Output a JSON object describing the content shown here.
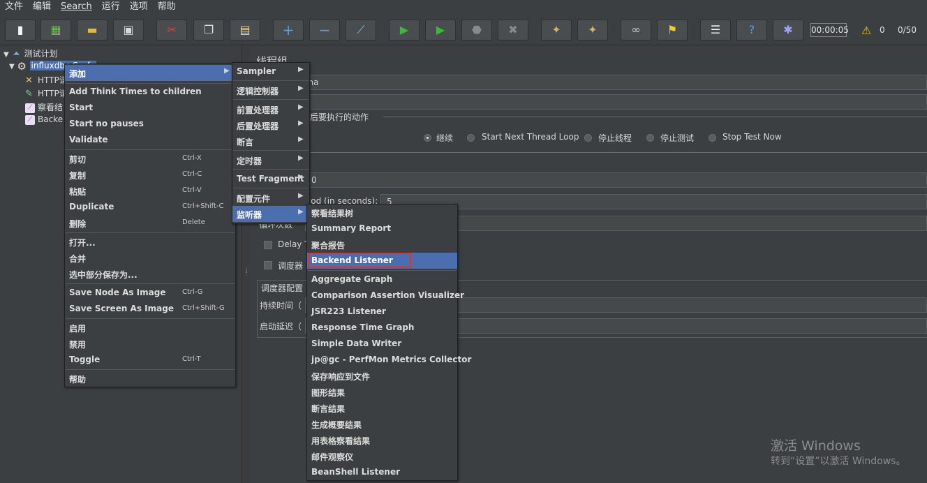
{
  "menubar": [
    "文件",
    "编辑",
    "Search",
    "运行",
    "选项",
    "帮助"
  ],
  "toolbar": {
    "timer": "00:00:05",
    "warn_count": "0",
    "threads": "0/50"
  },
  "tree": {
    "root": "测试计划",
    "thread_group": "influxdb+Grafana",
    "thread_group_visible": "influxdb+Grafa",
    "children": [
      "HTTP请",
      "HTTP请",
      "察看结",
      "Backe"
    ]
  },
  "panel": {
    "title": "线程组",
    "name_value": "xdb+Grafana",
    "action_section": "误后要执行的动作",
    "radios": [
      "继续",
      "Start Next Thread Loop",
      "停止线程",
      "停止测试",
      "Stop Test Now"
    ],
    "threads_value": "0",
    "rampup_label": "riod (in seconds):",
    "rampup_value": "5",
    "loop_label": "循环次数",
    "delay_label": "Delay T",
    "scheduler_label": "调度器",
    "scheduler_section": "调度器配置",
    "duration_label": "持续时间（",
    "startup_label": "启动延迟（"
  },
  "context_menu": {
    "items": [
      {
        "label": "添加",
        "shortcut": "",
        "submenu": true,
        "highlight": true
      },
      {
        "label": "Add Think Times to children",
        "shortcut": ""
      },
      {
        "label": "Start",
        "shortcut": ""
      },
      {
        "label": "Start no pauses",
        "shortcut": ""
      },
      {
        "label": "Validate",
        "shortcut": ""
      },
      {
        "label": "剪切",
        "shortcut": "Ctrl-X"
      },
      {
        "label": "复制",
        "shortcut": "Ctrl-C"
      },
      {
        "label": "粘贴",
        "shortcut": "Ctrl-V"
      },
      {
        "label": "Duplicate",
        "shortcut": "Ctrl+Shift-C"
      },
      {
        "label": "删除",
        "shortcut": "Delete"
      },
      {
        "label": "打开...",
        "shortcut": ""
      },
      {
        "label": "合并",
        "shortcut": ""
      },
      {
        "label": "选中部分保存为...",
        "shortcut": ""
      },
      {
        "label": "Save Node As Image",
        "shortcut": "Ctrl-G"
      },
      {
        "label": "Save Screen As Image",
        "shortcut": "Ctrl+Shift-G"
      },
      {
        "label": "启用",
        "shortcut": ""
      },
      {
        "label": "禁用",
        "shortcut": ""
      },
      {
        "label": "Toggle",
        "shortcut": "Ctrl-T"
      },
      {
        "label": "帮助",
        "shortcut": ""
      }
    ]
  },
  "add_submenu": {
    "items": [
      "Sampler",
      "逻辑控制器",
      "前置处理器",
      "后置处理器",
      "断言",
      "定时器",
      "Test Fragment",
      "配置元件",
      "监听器"
    ]
  },
  "listener_submenu": {
    "items": [
      "察看结果树",
      "Summary Report",
      "聚合报告",
      "Backend Listener",
      "Aggregate Graph",
      "Comparison Assertion Visualizer",
      "JSR223 Listener",
      "Response Time Graph",
      "Simple Data Writer",
      "jp@gc - PerfMon Metrics Collector",
      "保存响应到文件",
      "图形结果",
      "断言结果",
      "生成概要结果",
      "用表格察看结果",
      "邮件观察仪",
      "BeanShell Listener"
    ]
  },
  "watermark": {
    "line1": "激活 Windows",
    "line2": "转到“设置”以激活 Windows。"
  },
  "colors": {
    "background": "#3c3f41",
    "highlight": "#4b6eaf",
    "red_box": "#e0322d"
  }
}
